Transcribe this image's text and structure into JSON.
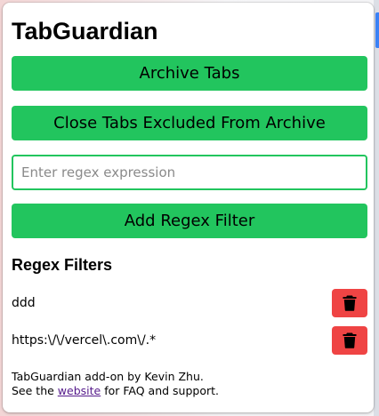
{
  "app": {
    "title": "TabGuardian"
  },
  "actions": {
    "archive_label": "Archive Tabs",
    "close_excluded_label": "Close Tabs Excluded From Archive",
    "add_filter_label": "Add Regex Filter"
  },
  "regex_input": {
    "value": "",
    "placeholder": "Enter regex expression"
  },
  "filters": {
    "heading": "Regex Filters",
    "items": [
      {
        "pattern": "ddd",
        "delete_icon": "trash-icon"
      },
      {
        "pattern": "https:\\/\\/vercel\\.com\\/.*",
        "delete_icon": "trash-icon"
      }
    ]
  },
  "footer": {
    "line1": "TabGuardian add-on by Kevin Zhu.",
    "line2_prefix": "See the ",
    "link_text": "website",
    "line2_suffix": " for FAQ and support."
  },
  "colors": {
    "primary_green": "#22c55e",
    "danger_red": "#ef4444",
    "link_visited": "#551a8b"
  }
}
